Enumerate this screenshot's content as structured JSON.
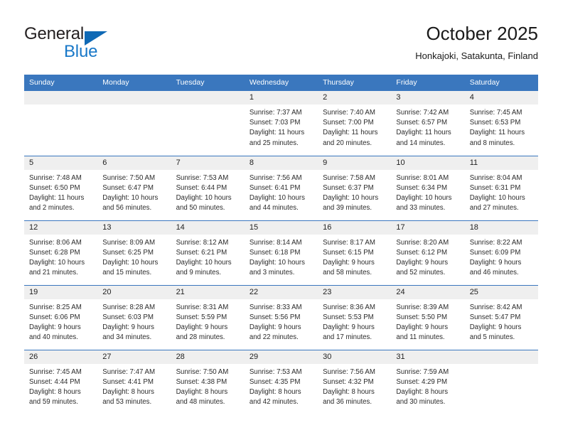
{
  "logo": {
    "word1": "General",
    "word2": "Blue",
    "triangle_color": "#0f69b5",
    "word2_color": "#1878c8"
  },
  "header": {
    "title": "October 2025",
    "subtitle": "Honkajoki, Satakunta, Finland"
  },
  "theme": {
    "header_blue": "#3a77be",
    "daynum_band": "#efefef",
    "text": "#2b2b2b"
  },
  "calendar": {
    "weekday_headers": [
      "Sunday",
      "Monday",
      "Tuesday",
      "Wednesday",
      "Thursday",
      "Friday",
      "Saturday"
    ],
    "weeks": [
      [
        {
          "day": "",
          "lines": []
        },
        {
          "day": "",
          "lines": []
        },
        {
          "day": "",
          "lines": []
        },
        {
          "day": "1",
          "lines": [
            "Sunrise: 7:37 AM",
            "Sunset: 7:03 PM",
            "Daylight: 11 hours",
            "and 25 minutes."
          ]
        },
        {
          "day": "2",
          "lines": [
            "Sunrise: 7:40 AM",
            "Sunset: 7:00 PM",
            "Daylight: 11 hours",
            "and 20 minutes."
          ]
        },
        {
          "day": "3",
          "lines": [
            "Sunrise: 7:42 AM",
            "Sunset: 6:57 PM",
            "Daylight: 11 hours",
            "and 14 minutes."
          ]
        },
        {
          "day": "4",
          "lines": [
            "Sunrise: 7:45 AM",
            "Sunset: 6:53 PM",
            "Daylight: 11 hours",
            "and 8 minutes."
          ]
        }
      ],
      [
        {
          "day": "5",
          "lines": [
            "Sunrise: 7:48 AM",
            "Sunset: 6:50 PM",
            "Daylight: 11 hours",
            "and 2 minutes."
          ]
        },
        {
          "day": "6",
          "lines": [
            "Sunrise: 7:50 AM",
            "Sunset: 6:47 PM",
            "Daylight: 10 hours",
            "and 56 minutes."
          ]
        },
        {
          "day": "7",
          "lines": [
            "Sunrise: 7:53 AM",
            "Sunset: 6:44 PM",
            "Daylight: 10 hours",
            "and 50 minutes."
          ]
        },
        {
          "day": "8",
          "lines": [
            "Sunrise: 7:56 AM",
            "Sunset: 6:41 PM",
            "Daylight: 10 hours",
            "and 44 minutes."
          ]
        },
        {
          "day": "9",
          "lines": [
            "Sunrise: 7:58 AM",
            "Sunset: 6:37 PM",
            "Daylight: 10 hours",
            "and 39 minutes."
          ]
        },
        {
          "day": "10",
          "lines": [
            "Sunrise: 8:01 AM",
            "Sunset: 6:34 PM",
            "Daylight: 10 hours",
            "and 33 minutes."
          ]
        },
        {
          "day": "11",
          "lines": [
            "Sunrise: 8:04 AM",
            "Sunset: 6:31 PM",
            "Daylight: 10 hours",
            "and 27 minutes."
          ]
        }
      ],
      [
        {
          "day": "12",
          "lines": [
            "Sunrise: 8:06 AM",
            "Sunset: 6:28 PM",
            "Daylight: 10 hours",
            "and 21 minutes."
          ]
        },
        {
          "day": "13",
          "lines": [
            "Sunrise: 8:09 AM",
            "Sunset: 6:25 PM",
            "Daylight: 10 hours",
            "and 15 minutes."
          ]
        },
        {
          "day": "14",
          "lines": [
            "Sunrise: 8:12 AM",
            "Sunset: 6:21 PM",
            "Daylight: 10 hours",
            "and 9 minutes."
          ]
        },
        {
          "day": "15",
          "lines": [
            "Sunrise: 8:14 AM",
            "Sunset: 6:18 PM",
            "Daylight: 10 hours",
            "and 3 minutes."
          ]
        },
        {
          "day": "16",
          "lines": [
            "Sunrise: 8:17 AM",
            "Sunset: 6:15 PM",
            "Daylight: 9 hours",
            "and 58 minutes."
          ]
        },
        {
          "day": "17",
          "lines": [
            "Sunrise: 8:20 AM",
            "Sunset: 6:12 PM",
            "Daylight: 9 hours",
            "and 52 minutes."
          ]
        },
        {
          "day": "18",
          "lines": [
            "Sunrise: 8:22 AM",
            "Sunset: 6:09 PM",
            "Daylight: 9 hours",
            "and 46 minutes."
          ]
        }
      ],
      [
        {
          "day": "19",
          "lines": [
            "Sunrise: 8:25 AM",
            "Sunset: 6:06 PM",
            "Daylight: 9 hours",
            "and 40 minutes."
          ]
        },
        {
          "day": "20",
          "lines": [
            "Sunrise: 8:28 AM",
            "Sunset: 6:03 PM",
            "Daylight: 9 hours",
            "and 34 minutes."
          ]
        },
        {
          "day": "21",
          "lines": [
            "Sunrise: 8:31 AM",
            "Sunset: 5:59 PM",
            "Daylight: 9 hours",
            "and 28 minutes."
          ]
        },
        {
          "day": "22",
          "lines": [
            "Sunrise: 8:33 AM",
            "Sunset: 5:56 PM",
            "Daylight: 9 hours",
            "and 22 minutes."
          ]
        },
        {
          "day": "23",
          "lines": [
            "Sunrise: 8:36 AM",
            "Sunset: 5:53 PM",
            "Daylight: 9 hours",
            "and 17 minutes."
          ]
        },
        {
          "day": "24",
          "lines": [
            "Sunrise: 8:39 AM",
            "Sunset: 5:50 PM",
            "Daylight: 9 hours",
            "and 11 minutes."
          ]
        },
        {
          "day": "25",
          "lines": [
            "Sunrise: 8:42 AM",
            "Sunset: 5:47 PM",
            "Daylight: 9 hours",
            "and 5 minutes."
          ]
        }
      ],
      [
        {
          "day": "26",
          "lines": [
            "Sunrise: 7:45 AM",
            "Sunset: 4:44 PM",
            "Daylight: 8 hours",
            "and 59 minutes."
          ]
        },
        {
          "day": "27",
          "lines": [
            "Sunrise: 7:47 AM",
            "Sunset: 4:41 PM",
            "Daylight: 8 hours",
            "and 53 minutes."
          ]
        },
        {
          "day": "28",
          "lines": [
            "Sunrise: 7:50 AM",
            "Sunset: 4:38 PM",
            "Daylight: 8 hours",
            "and 48 minutes."
          ]
        },
        {
          "day": "29",
          "lines": [
            "Sunrise: 7:53 AM",
            "Sunset: 4:35 PM",
            "Daylight: 8 hours",
            "and 42 minutes."
          ]
        },
        {
          "day": "30",
          "lines": [
            "Sunrise: 7:56 AM",
            "Sunset: 4:32 PM",
            "Daylight: 8 hours",
            "and 36 minutes."
          ]
        },
        {
          "day": "31",
          "lines": [
            "Sunrise: 7:59 AM",
            "Sunset: 4:29 PM",
            "Daylight: 8 hours",
            "and 30 minutes."
          ]
        },
        {
          "day": "",
          "lines": []
        }
      ]
    ]
  }
}
